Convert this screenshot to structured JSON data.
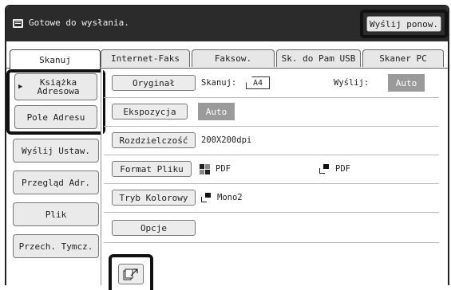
{
  "status": {
    "message": "Gotowe do wysłania.",
    "resend_label": "Wyślij ponow."
  },
  "tabs": [
    {
      "label": "Skanuj",
      "active": true
    },
    {
      "label": "Internet-Faks",
      "active": false
    },
    {
      "label": "Faksow.",
      "active": false
    },
    {
      "label": "Sk. do Pam USB",
      "active": false
    },
    {
      "label": "Skaner PC",
      "active": false
    }
  ],
  "sidebar": {
    "address_book": "Książka\nAdresowa",
    "address_field": "Pole Adresu",
    "send_settings": "Wyślij Ustaw.",
    "address_review": "Przegląd Adr.",
    "file": "Plik",
    "quick_file": "Przech. Tymcz."
  },
  "settings": {
    "original": {
      "label": "Oryginał",
      "scan_label": "Skanuj:",
      "scan_size": "A4",
      "send_label": "Wyślij:",
      "send_value": "Auto"
    },
    "exposure": {
      "label": "Ekspozycja",
      "value": "Auto"
    },
    "resolution": {
      "label": "Rozdzielczość",
      "value": "200X200dpi"
    },
    "file_format": {
      "label": "Format Pliku",
      "bw_value": "PDF",
      "color_value": "PDF"
    },
    "color_mode": {
      "label": "Tryb Kolorowy",
      "value": "Mono2"
    },
    "options": {
      "label": "Opcje"
    }
  },
  "colors": {
    "status_bg": "#2b2b2b",
    "highlight": "#111111",
    "auto_bg": "#9a9a9a"
  }
}
